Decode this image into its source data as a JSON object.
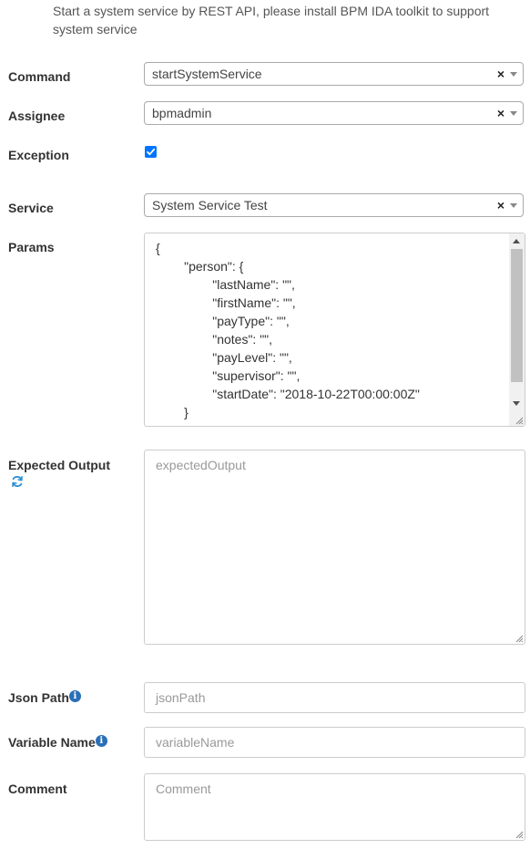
{
  "description": "Start a system service by REST API, please install BPM IDA toolkit to support system service",
  "labels": {
    "command": "Command",
    "assignee": "Assignee",
    "exception": "Exception",
    "service": "Service",
    "params": "Params",
    "expected_output": "Expected Output",
    "json_path": "Json Path",
    "variable_name": "Variable Name",
    "comment": "Comment"
  },
  "fields": {
    "command": "startSystemService",
    "assignee": "bpmadmin",
    "exception_checked": true,
    "service": "System Service Test",
    "params_lines": [
      "{",
      "        \"person\": {",
      "                \"lastName\": \"\",",
      "                \"firstName\": \"\",",
      "                \"payType\": \"\",",
      "                \"notes\": \"\",",
      "                \"payLevel\": \"\",",
      "                \"supervisor\": \"\",",
      "                \"startDate\": \"2018-10-22T00:00:00Z\"",
      "        }",
      "}"
    ]
  },
  "placeholders": {
    "expected_output": "expectedOutput",
    "json_path": "jsonPath",
    "variable_name": "variableName",
    "comment": "Comment"
  },
  "select_clear_glyph": "×",
  "icons": {
    "info": "info-circle-icon",
    "refresh": "refresh-icon",
    "clear": "clear-icon",
    "dropdown": "chevron-down-icon"
  },
  "colors": {
    "checkbox": "#0075ff",
    "info_icon": "#2a6fb7",
    "refresh_icon": "#2a8fd4"
  }
}
